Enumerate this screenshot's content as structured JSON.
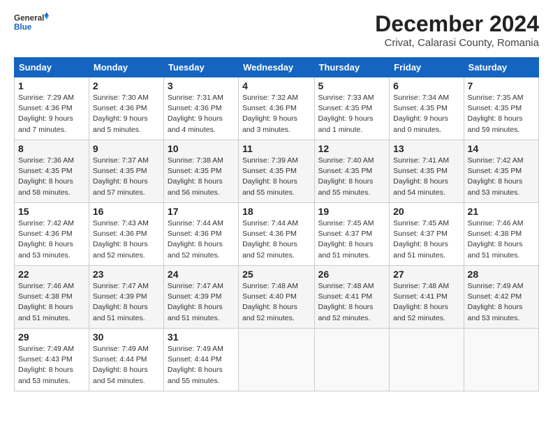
{
  "header": {
    "logo_general": "General",
    "logo_blue": "Blue",
    "month_title": "December 2024",
    "subtitle": "Crivat, Calarasi County, Romania"
  },
  "weekdays": [
    "Sunday",
    "Monday",
    "Tuesday",
    "Wednesday",
    "Thursday",
    "Friday",
    "Saturday"
  ],
  "weeks": [
    [
      {
        "day": "1",
        "sunrise": "Sunrise: 7:29 AM",
        "sunset": "Sunset: 4:36 PM",
        "daylight": "Daylight: 9 hours and 7 minutes."
      },
      {
        "day": "2",
        "sunrise": "Sunrise: 7:30 AM",
        "sunset": "Sunset: 4:36 PM",
        "daylight": "Daylight: 9 hours and 5 minutes."
      },
      {
        "day": "3",
        "sunrise": "Sunrise: 7:31 AM",
        "sunset": "Sunset: 4:36 PM",
        "daylight": "Daylight: 9 hours and 4 minutes."
      },
      {
        "day": "4",
        "sunrise": "Sunrise: 7:32 AM",
        "sunset": "Sunset: 4:36 PM",
        "daylight": "Daylight: 9 hours and 3 minutes."
      },
      {
        "day": "5",
        "sunrise": "Sunrise: 7:33 AM",
        "sunset": "Sunset: 4:35 PM",
        "daylight": "Daylight: 9 hours and 1 minute."
      },
      {
        "day": "6",
        "sunrise": "Sunrise: 7:34 AM",
        "sunset": "Sunset: 4:35 PM",
        "daylight": "Daylight: 9 hours and 0 minutes."
      },
      {
        "day": "7",
        "sunrise": "Sunrise: 7:35 AM",
        "sunset": "Sunset: 4:35 PM",
        "daylight": "Daylight: 8 hours and 59 minutes."
      }
    ],
    [
      {
        "day": "8",
        "sunrise": "Sunrise: 7:36 AM",
        "sunset": "Sunset: 4:35 PM",
        "daylight": "Daylight: 8 hours and 58 minutes."
      },
      {
        "day": "9",
        "sunrise": "Sunrise: 7:37 AM",
        "sunset": "Sunset: 4:35 PM",
        "daylight": "Daylight: 8 hours and 57 minutes."
      },
      {
        "day": "10",
        "sunrise": "Sunrise: 7:38 AM",
        "sunset": "Sunset: 4:35 PM",
        "daylight": "Daylight: 8 hours and 56 minutes."
      },
      {
        "day": "11",
        "sunrise": "Sunrise: 7:39 AM",
        "sunset": "Sunset: 4:35 PM",
        "daylight": "Daylight: 8 hours and 55 minutes."
      },
      {
        "day": "12",
        "sunrise": "Sunrise: 7:40 AM",
        "sunset": "Sunset: 4:35 PM",
        "daylight": "Daylight: 8 hours and 55 minutes."
      },
      {
        "day": "13",
        "sunrise": "Sunrise: 7:41 AM",
        "sunset": "Sunset: 4:35 PM",
        "daylight": "Daylight: 8 hours and 54 minutes."
      },
      {
        "day": "14",
        "sunrise": "Sunrise: 7:42 AM",
        "sunset": "Sunset: 4:35 PM",
        "daylight": "Daylight: 8 hours and 53 minutes."
      }
    ],
    [
      {
        "day": "15",
        "sunrise": "Sunrise: 7:42 AM",
        "sunset": "Sunset: 4:36 PM",
        "daylight": "Daylight: 8 hours and 53 minutes."
      },
      {
        "day": "16",
        "sunrise": "Sunrise: 7:43 AM",
        "sunset": "Sunset: 4:36 PM",
        "daylight": "Daylight: 8 hours and 52 minutes."
      },
      {
        "day": "17",
        "sunrise": "Sunrise: 7:44 AM",
        "sunset": "Sunset: 4:36 PM",
        "daylight": "Daylight: 8 hours and 52 minutes."
      },
      {
        "day": "18",
        "sunrise": "Sunrise: 7:44 AM",
        "sunset": "Sunset: 4:36 PM",
        "daylight": "Daylight: 8 hours and 52 minutes."
      },
      {
        "day": "19",
        "sunrise": "Sunrise: 7:45 AM",
        "sunset": "Sunset: 4:37 PM",
        "daylight": "Daylight: 8 hours and 51 minutes."
      },
      {
        "day": "20",
        "sunrise": "Sunrise: 7:45 AM",
        "sunset": "Sunset: 4:37 PM",
        "daylight": "Daylight: 8 hours and 51 minutes."
      },
      {
        "day": "21",
        "sunrise": "Sunrise: 7:46 AM",
        "sunset": "Sunset: 4:38 PM",
        "daylight": "Daylight: 8 hours and 51 minutes."
      }
    ],
    [
      {
        "day": "22",
        "sunrise": "Sunrise: 7:46 AM",
        "sunset": "Sunset: 4:38 PM",
        "daylight": "Daylight: 8 hours and 51 minutes."
      },
      {
        "day": "23",
        "sunrise": "Sunrise: 7:47 AM",
        "sunset": "Sunset: 4:39 PM",
        "daylight": "Daylight: 8 hours and 51 minutes."
      },
      {
        "day": "24",
        "sunrise": "Sunrise: 7:47 AM",
        "sunset": "Sunset: 4:39 PM",
        "daylight": "Daylight: 8 hours and 51 minutes."
      },
      {
        "day": "25",
        "sunrise": "Sunrise: 7:48 AM",
        "sunset": "Sunset: 4:40 PM",
        "daylight": "Daylight: 8 hours and 52 minutes."
      },
      {
        "day": "26",
        "sunrise": "Sunrise: 7:48 AM",
        "sunset": "Sunset: 4:41 PM",
        "daylight": "Daylight: 8 hours and 52 minutes."
      },
      {
        "day": "27",
        "sunrise": "Sunrise: 7:48 AM",
        "sunset": "Sunset: 4:41 PM",
        "daylight": "Daylight: 8 hours and 52 minutes."
      },
      {
        "day": "28",
        "sunrise": "Sunrise: 7:49 AM",
        "sunset": "Sunset: 4:42 PM",
        "daylight": "Daylight: 8 hours and 53 minutes."
      }
    ],
    [
      {
        "day": "29",
        "sunrise": "Sunrise: 7:49 AM",
        "sunset": "Sunset: 4:43 PM",
        "daylight": "Daylight: 8 hours and 53 minutes."
      },
      {
        "day": "30",
        "sunrise": "Sunrise: 7:49 AM",
        "sunset": "Sunset: 4:44 PM",
        "daylight": "Daylight: 8 hours and 54 minutes."
      },
      {
        "day": "31",
        "sunrise": "Sunrise: 7:49 AM",
        "sunset": "Sunset: 4:44 PM",
        "daylight": "Daylight: 8 hours and 55 minutes."
      },
      null,
      null,
      null,
      null
    ]
  ]
}
